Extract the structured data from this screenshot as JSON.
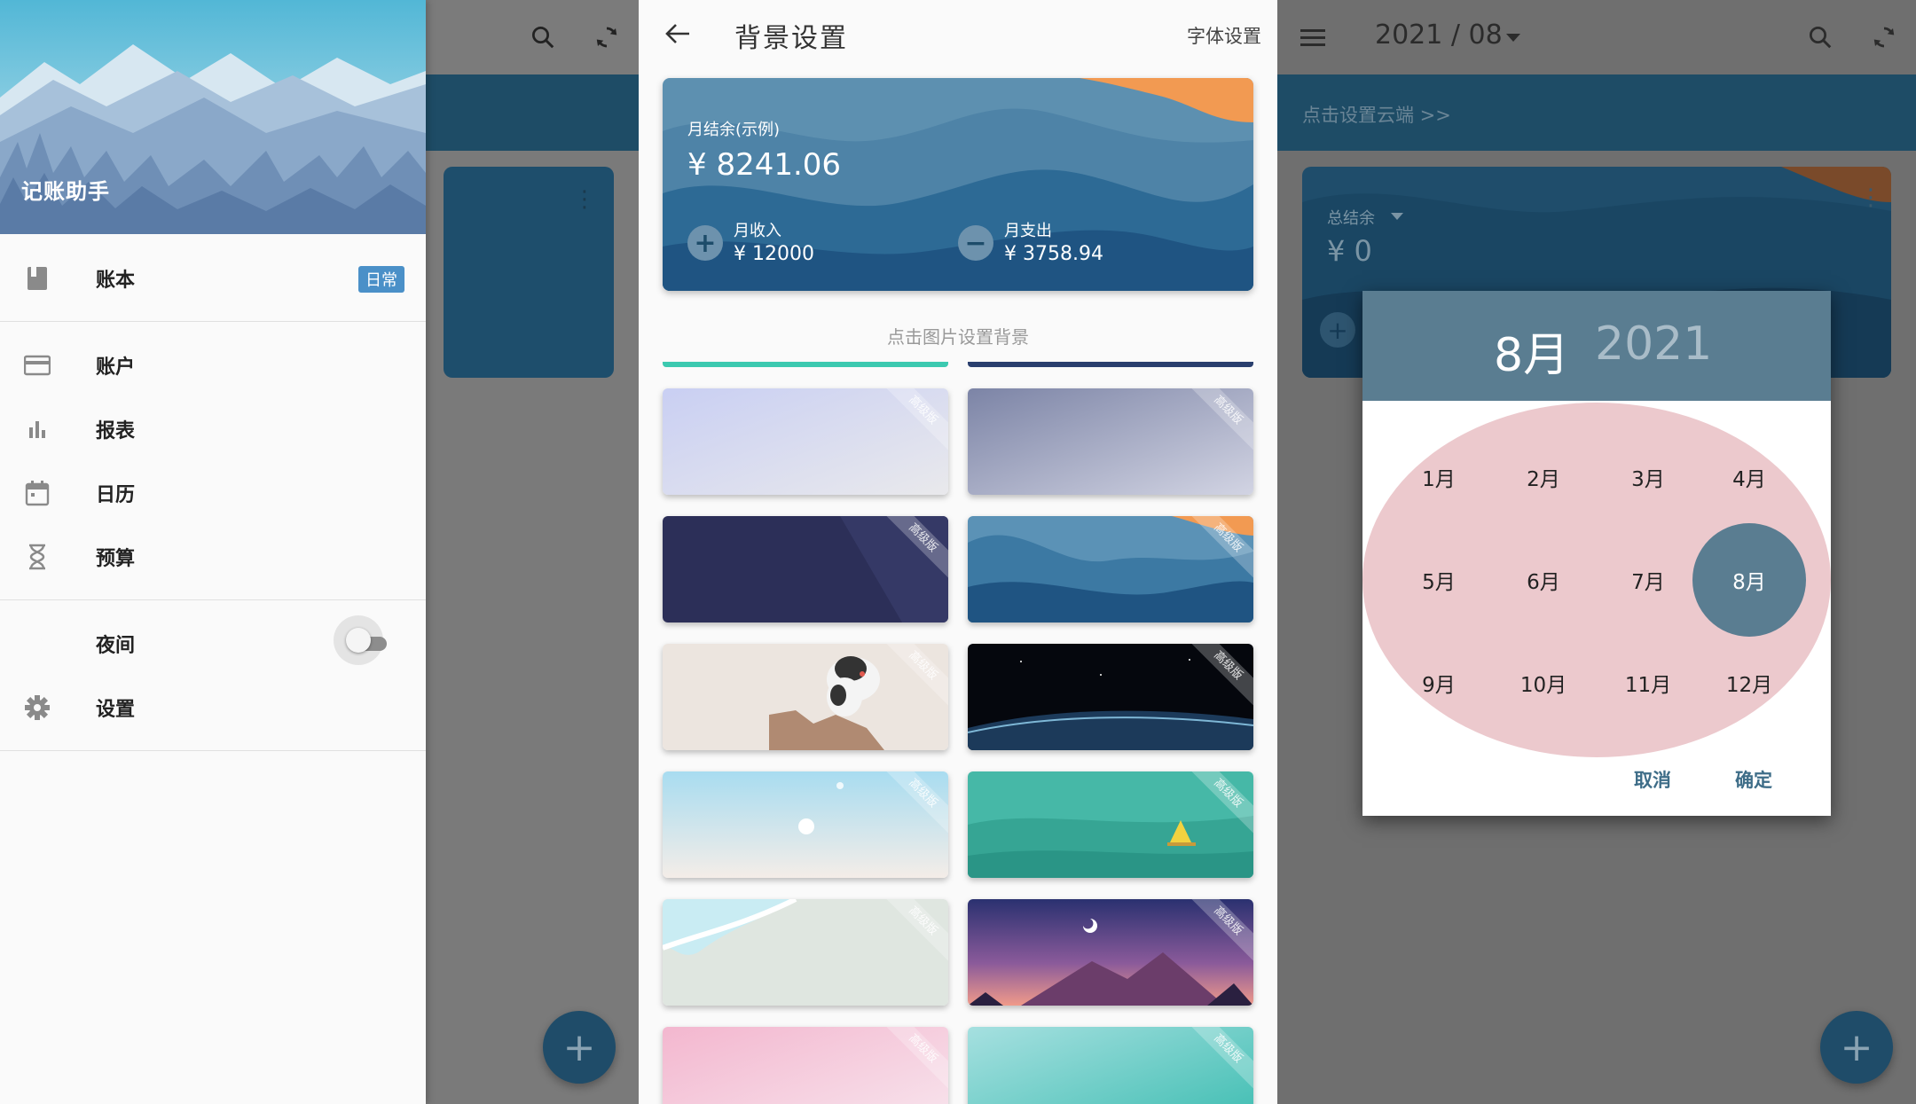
{
  "screen1": {
    "drawer": {
      "app_title": "记账助手",
      "items": [
        {
          "label": "账本",
          "icon": "book-icon",
          "badge": "日常"
        },
        {
          "label": "账户",
          "icon": "credit-card-icon"
        },
        {
          "label": "报表",
          "icon": "bar-chart-icon"
        },
        {
          "label": "日历",
          "icon": "calendar-icon"
        },
        {
          "label": "预算",
          "icon": "hourglass-icon"
        },
        {
          "label": "夜间",
          "icon": "moon-icon",
          "toggle": false
        },
        {
          "label": "设置",
          "icon": "gear-icon"
        }
      ]
    },
    "fab_label": "+"
  },
  "screen2": {
    "title": "背景设置",
    "font_settings": "字体设置",
    "preview": {
      "balance_label": "月结余(示例)",
      "balance_value": "¥ 8241.06",
      "income_label": "月收入",
      "income_value": "¥ 12000",
      "expense_label": "月支出",
      "expense_value": "¥ 3758.94",
      "income_sign": "+",
      "expense_sign": "−"
    },
    "hint": "点击图片设置背景",
    "thumb_ribbon": "高级版"
  },
  "screen3": {
    "date": "2021 / 08",
    "cloud_prompt": "点击设置云端 >>",
    "total_label": "总结余",
    "total_value": "¥ 0",
    "dialog": {
      "selected_month": "8月",
      "year": "2021",
      "months": [
        "1月",
        "2月",
        "3月",
        "4月",
        "5月",
        "6月",
        "7月",
        "8月",
        "9月",
        "10月",
        "11月",
        "12月"
      ],
      "cancel": "取消",
      "confirm": "确定"
    },
    "fab_label": "+"
  },
  "colors": {
    "primary_dark": "#1e4c66",
    "dialog_header": "#5a7d91",
    "badge": "#4a90c8",
    "month_oval": "#ecc9cd"
  }
}
